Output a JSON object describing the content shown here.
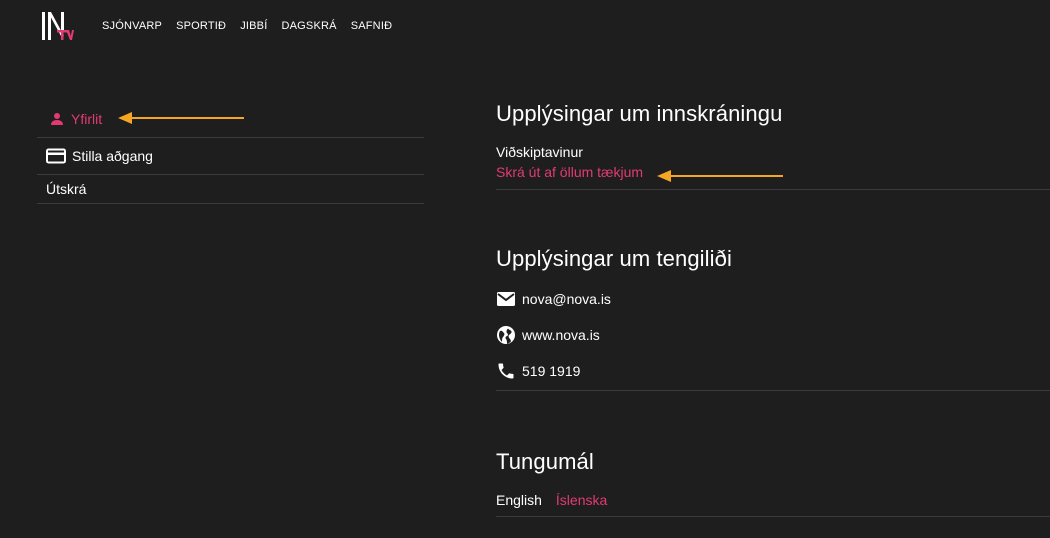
{
  "header": {
    "logo_alt": "Nova TV",
    "nav": [
      "SJÓNVARP",
      "SPORTIÐ",
      "JIBBÍ",
      "DAGSKRÁ",
      "SAFNIÐ"
    ]
  },
  "sidebar": {
    "items": [
      {
        "label": "Yfirlit",
        "icon": "person-icon",
        "active": true
      },
      {
        "label": "Stilla aðgang",
        "icon": "credit-card-icon",
        "active": false
      },
      {
        "label": "Útskrá",
        "icon": "",
        "active": false
      }
    ]
  },
  "login_info": {
    "title": "Upplýsingar um innskráningu",
    "account_type": "Viðskiptavinur",
    "logout_all_link": "Skrá út af öllum tækjum"
  },
  "contact_info": {
    "title": "Upplýsingar um tengiliði",
    "email": "nova@nova.is",
    "website": "www.nova.is",
    "phone": "519 1919"
  },
  "language": {
    "title": "Tungumál",
    "options": [
      "English",
      "Íslenska"
    ],
    "selected": "Íslenska"
  },
  "colors": {
    "background": "#1e1e1e",
    "accent": "#e23b74",
    "annotation_arrow": "#f5a623",
    "divider": "#3b3b3b"
  }
}
